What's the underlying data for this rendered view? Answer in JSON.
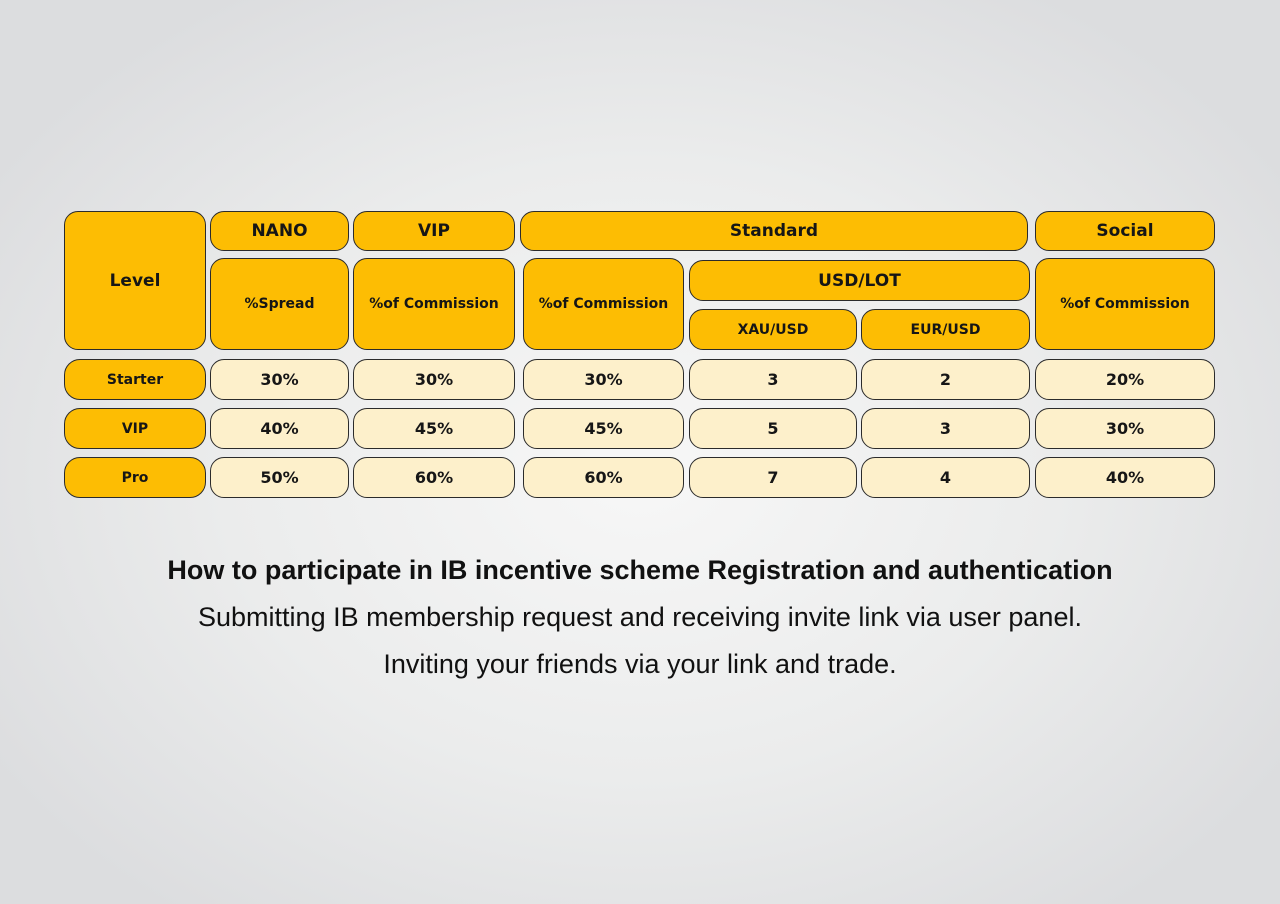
{
  "table": {
    "headers": {
      "level": "Level",
      "nano": "NANO",
      "vip": "VIP",
      "standard": "Standard",
      "social": "Social",
      "nano_spread": "%Spread",
      "vip_commission": "%of Commission",
      "standard_commission": "%of Commission",
      "usd_lot": "USD/LOT",
      "xau_usd": "XAU/USD",
      "eur_usd": "EUR/USD",
      "social_commission": "%of Commission"
    },
    "rows": [
      {
        "level": "Starter",
        "nano_spread": "30%",
        "vip_commission": "30%",
        "standard_commission": "30%",
        "xau_usd": "3",
        "eur_usd": "2",
        "social_commission": "20%"
      },
      {
        "level": "VIP",
        "nano_spread": "40%",
        "vip_commission": "45%",
        "standard_commission": "45%",
        "xau_usd": "5",
        "eur_usd": "3",
        "social_commission": "30%"
      },
      {
        "level": "Pro",
        "nano_spread": "50%",
        "vip_commission": "60%",
        "standard_commission": "60%",
        "xau_usd": "7",
        "eur_usd": "4",
        "social_commission": "40%"
      }
    ]
  },
  "info": {
    "title": "How to participate in IB incentive scheme Registration and authentication",
    "line1": "Submitting IB membership request and receiving invite link via user panel.",
    "line2": "Inviting your friends via your link and trade."
  },
  "colors": {
    "header_fill": "#fdbd03",
    "value_fill": "#fdf0cb",
    "border": "#2b2b2b",
    "text": "#161616"
  }
}
